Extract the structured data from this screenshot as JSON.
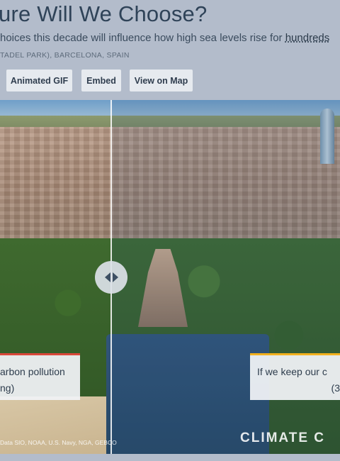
{
  "header": {
    "title": "ure Will We Choose?",
    "subtitle_prefix": "hoices this decade will influence how high sea levels rise for ",
    "subtitle_link": "hundreds",
    "location": "TADEL PARK), BARCELONA, SPAIN"
  },
  "toolbar": {
    "gif_label": "Animated GIF",
    "embed_label": "Embed",
    "map_label": "View on Map"
  },
  "viewer": {
    "left_caption_line1": "arbon pollution",
    "left_caption_line2": "ng)",
    "right_caption_line1": "If we keep our c",
    "right_caption_line2": "(3",
    "credits": "Data SIO, NOAA, U.S. Navy, NGA, GEBCO",
    "brand": "CLIMATE C",
    "left_accent": "#d9483a",
    "right_accent": "#f2b01e"
  }
}
